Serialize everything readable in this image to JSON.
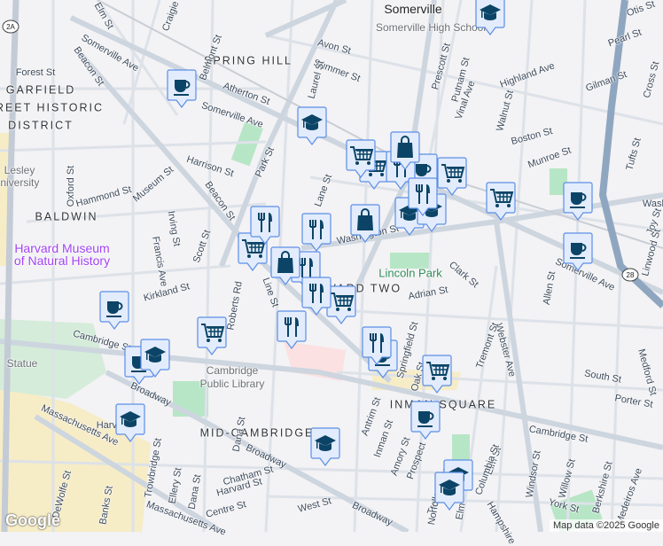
{
  "map": {
    "town": "Somerville",
    "areas": [
      "SPRING HILL",
      "GARFIELD",
      "STREET HISTORIC",
      "DISTRICT",
      "BALDWIN",
      "MID-CAMBRIDGE",
      "WARD TWO",
      "INMAN SQUARE"
    ],
    "pois": [
      "Somerville High School",
      "Lesley",
      "University",
      "Cambridge",
      "Public Library",
      "Statue"
    ],
    "museum": [
      "Harvard Museum",
      "of Natural History"
    ],
    "park": "Lincoln Park",
    "streets": [
      "Elm St",
      "Craigie St",
      "Belmont St",
      "Avon St",
      "Summer St",
      "Somerville Ave",
      "Beacon St",
      "Forest St",
      "Atherton St",
      "Somerville Ave",
      "Harrison St",
      "Park St",
      "Museum St",
      "Hammond St",
      "Oxford St",
      "Beacon St",
      "Irving St",
      "Scott St",
      "Francis Ave",
      "Kirkland St",
      "Washington St",
      "Lane St",
      "Laurel St",
      "Prescott St",
      "Putnam St",
      "Vinal Ave",
      "Highland Ave",
      "Gilman St",
      "Pearl St",
      "Otis St",
      "Cross St",
      "Walnut St",
      "Boston St",
      "Munroe St",
      "Tufts St",
      "Washi",
      "Joy St",
      "Linwood St",
      "Allen St",
      "Somerville Ave",
      "Clark St",
      "Adrian St",
      "Webster Ave",
      "Tremont St",
      "Springfield St",
      "Oak St",
      "South St",
      "Porter St",
      "Medford St",
      "Cambridge St",
      "Elm St",
      "Columbia St",
      "Windsor St",
      "Willow St",
      "Berkshire St",
      "Medeiros Ave",
      "York St",
      "Antrim St",
      "Inman St",
      "Amory St",
      "Prospect",
      "Tremont St",
      "Norfolk",
      "Elm",
      "Hampshire",
      "Broadway",
      "Broadway",
      "Cambridge St",
      "Broadway",
      "Dana St",
      "Roberts Rd",
      "Line St",
      "Harvard St",
      "Massachusetts Ave",
      "Trowbridge St",
      "Ellery St",
      "Chatham St",
      "Harvard St",
      "Dana St",
      "Centre St",
      "West St",
      "Banks St",
      "Massachusetts Ave",
      "DeWolfe St"
    ],
    "route_shields": [
      "2A",
      "28"
    ],
    "attribution": "Map data ©2025 Google",
    "logo": "Google"
  },
  "markers": [
    {
      "type": "coffee"
    },
    {
      "type": "coffee"
    },
    {
      "type": "coffee"
    },
    {
      "type": "coffee"
    },
    {
      "type": "coffee"
    },
    {
      "type": "coffee"
    },
    {
      "type": "coffee"
    },
    {
      "type": "coffee"
    },
    {
      "type": "school"
    },
    {
      "type": "school"
    },
    {
      "type": "school"
    },
    {
      "type": "school"
    },
    {
      "type": "school"
    },
    {
      "type": "school"
    },
    {
      "type": "school"
    },
    {
      "type": "school"
    },
    {
      "type": "school"
    },
    {
      "type": "grocery"
    },
    {
      "type": "grocery"
    },
    {
      "type": "grocery"
    },
    {
      "type": "grocery"
    },
    {
      "type": "grocery"
    },
    {
      "type": "grocery"
    },
    {
      "type": "grocery"
    },
    {
      "type": "grocery"
    },
    {
      "type": "restaurant"
    },
    {
      "type": "restaurant"
    },
    {
      "type": "restaurant"
    },
    {
      "type": "restaurant"
    },
    {
      "type": "restaurant"
    },
    {
      "type": "restaurant"
    },
    {
      "type": "restaurant"
    },
    {
      "type": "restaurant"
    },
    {
      "type": "shopping"
    },
    {
      "type": "shopping"
    },
    {
      "type": "shopping"
    }
  ],
  "colors": {
    "marker_fill": "#e3ecfc",
    "marker_border": "#5b8ee6",
    "icon": "#0b4466",
    "road": "#d3dae3",
    "highway": "#8fa6c0",
    "park": "#b4e6c4",
    "campus": "#f5ebc9"
  }
}
